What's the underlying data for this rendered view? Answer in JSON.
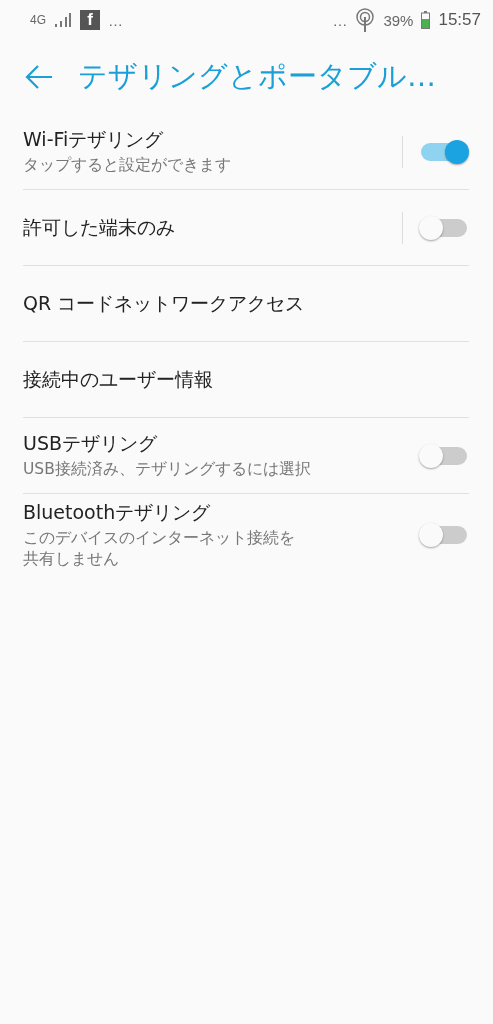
{
  "status_bar": {
    "network": "4G",
    "notification_app": "f",
    "more_left": "…",
    "more_right": "…",
    "battery": "39%",
    "time": "15:57"
  },
  "app_bar": {
    "title": "テザリングとポータブル…"
  },
  "settings": [
    {
      "kind": "switch",
      "title": "Wi-Fiテザリング",
      "subtitle": [
        "タップすると設定ができます"
      ],
      "on": true,
      "divider": true
    },
    {
      "kind": "switch",
      "title": "許可した端末のみ",
      "on": false,
      "divider": true
    },
    {
      "kind": "plain",
      "title": "QR コードネットワークアクセス"
    },
    {
      "kind": "plain",
      "title": "接続中のユーザー情報"
    },
    {
      "kind": "switch",
      "title": "USBテザリング",
      "subtitle": [
        "USB接続済み、テザリングするには選択"
      ],
      "on": false,
      "divider": false
    },
    {
      "kind": "switch",
      "title": "Bluetoothテザリング",
      "subtitle": [
        "このデバイスのインターネット接続を",
        "共有しません"
      ],
      "on": false,
      "divider": false
    }
  ]
}
